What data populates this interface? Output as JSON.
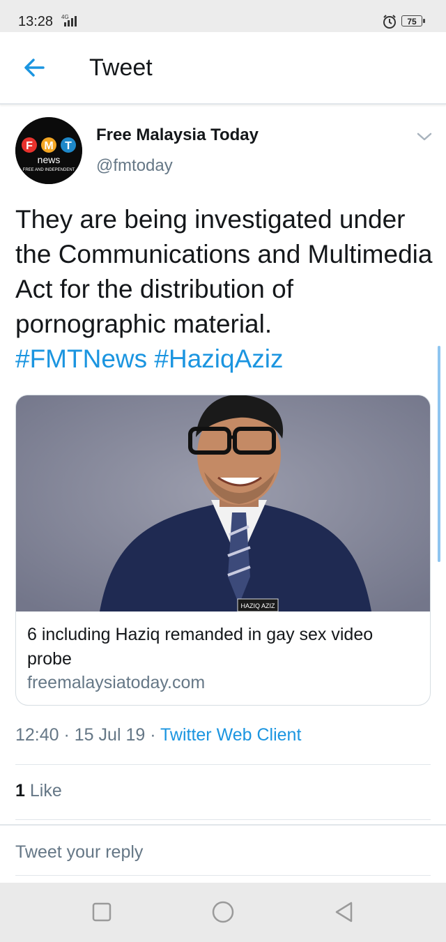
{
  "status_bar": {
    "time": "13:28",
    "network": "4G",
    "battery": "75"
  },
  "header": {
    "title": "Tweet",
    "back_icon": "arrow-left-icon"
  },
  "tweet": {
    "author_name": "Free Malaysia Today",
    "author_handle": "@fmtoday",
    "avatar": {
      "letters": [
        "F",
        "M",
        "T"
      ],
      "sub": "news",
      "tagline": "FREE AND INDEPENDENT"
    },
    "text": "They are being investigated under the Communications and Multimedia Act for the distribution of pornographic material.",
    "hashtags": [
      "#FMTNews",
      "#HaziqAziz"
    ],
    "card": {
      "name_badge": "HAZIQ AZIZ",
      "title": "6 including Haziq remanded in gay sex video probe",
      "domain": "freemalaysiatoday.com"
    },
    "time": "12:40",
    "date": "15 Jul 19",
    "client": "Twitter Web Client",
    "like_count": "1",
    "like_label": "Like"
  },
  "reply": {
    "placeholder": "Tweet your reply"
  },
  "colors": {
    "link": "#1b95e0",
    "muted": "#657786",
    "text": "#14171a"
  },
  "nav_bar": {
    "icons": [
      "square-recents-icon",
      "circle-home-icon",
      "triangle-back-icon"
    ]
  }
}
